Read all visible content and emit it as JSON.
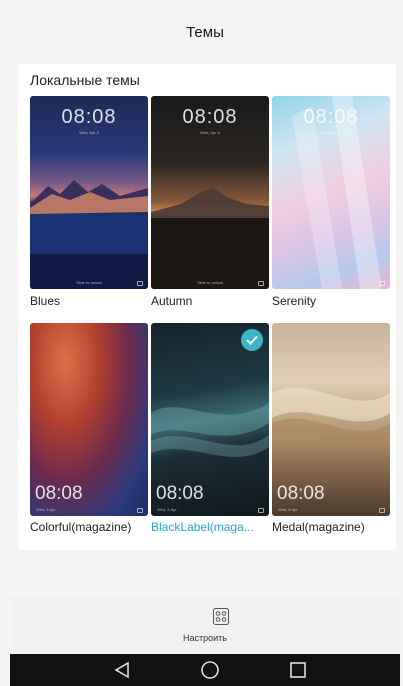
{
  "header": {
    "title": "Темы"
  },
  "local_themes": {
    "title": "Локальные темы",
    "items": [
      {
        "label": "Blues",
        "clock": "08:08",
        "date": "Wed, Apr 6",
        "slide": "Slide to unlock"
      },
      {
        "label": "Autumn",
        "clock": "08:08",
        "date": "Wed, Apr 6",
        "slide": "Slide to unlock"
      },
      {
        "label": "Serenity",
        "clock": "08:08",
        "date": "Wed, Apr 6"
      },
      {
        "label": "Colorful(magazine)",
        "clock": "08:08",
        "date": "Wed, 6 Apr"
      },
      {
        "label": "BlackLabel(maga...",
        "clock": "08:08",
        "date": "Wed, 6 Apr",
        "selected": true
      },
      {
        "label": "Medal(magazine)",
        "clock": "08:08",
        "date": "Wed, 6 Apr"
      }
    ]
  },
  "customize": {
    "label": "Настроить",
    "icon": "customize-grid-icon"
  },
  "navbar": {
    "icons": [
      "back-icon",
      "home-icon",
      "recents-icon"
    ]
  },
  "colors": {
    "accent": "#2aa7c2",
    "check": "#3cb5c9",
    "navbar": "#111111"
  }
}
